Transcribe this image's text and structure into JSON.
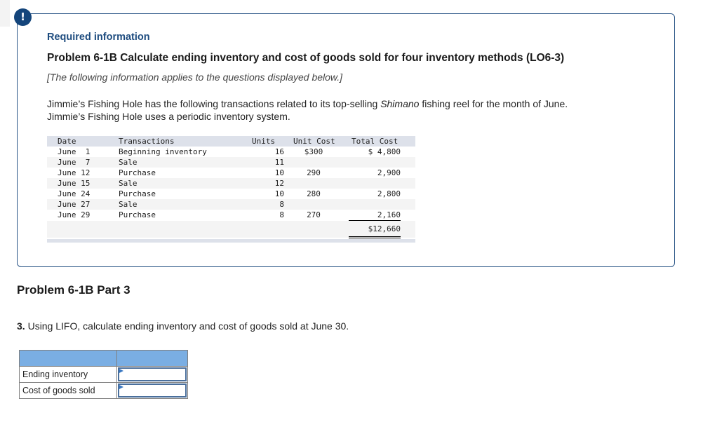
{
  "alert_icon": "!",
  "header": {
    "required_info": "Required information",
    "problem_title": "Problem 6-1B Calculate ending inventory and cost of goods sold for four inventory methods (LO6-3)",
    "applies_note": "[The following information applies to the questions displayed below.]"
  },
  "description": {
    "part1": "Jimmie’s Fishing Hole has the following transactions related to its top-selling ",
    "brand": "Shimano",
    "part2": " fishing reel for the month of June.",
    "line2": "Jimmie’s Fishing Hole uses a periodic inventory system."
  },
  "transactions": {
    "headers": {
      "date": "Date",
      "transactions": "Transactions",
      "units": "Units",
      "unit_cost": "Unit Cost",
      "total_cost": "Total Cost"
    },
    "rows": [
      {
        "date": "June  1",
        "transaction": "Beginning inventory",
        "units": "16",
        "unit_cost": "$300",
        "total_cost": "$ 4,800"
      },
      {
        "date": "June  7",
        "transaction": "Sale",
        "units": "11",
        "unit_cost": "",
        "total_cost": ""
      },
      {
        "date": "June 12",
        "transaction": "Purchase",
        "units": "10",
        "unit_cost": "290",
        "total_cost": "2,900"
      },
      {
        "date": "June 15",
        "transaction": "Sale",
        "units": "12",
        "unit_cost": "",
        "total_cost": ""
      },
      {
        "date": "June 24",
        "transaction": "Purchase",
        "units": "10",
        "unit_cost": "280",
        "total_cost": "2,800"
      },
      {
        "date": "June 27",
        "transaction": "Sale",
        "units": "8",
        "unit_cost": "",
        "total_cost": ""
      },
      {
        "date": "June 29",
        "transaction": "Purchase",
        "units": "8",
        "unit_cost": "270",
        "total_cost": "2,160"
      }
    ],
    "grand_total": "$12,660"
  },
  "part": {
    "title": "Problem 6-1B Part 3",
    "question_number": "3.",
    "question_text": " Using LIFO, calculate ending inventory and cost of goods sold at June 30."
  },
  "answer_table": {
    "rows": [
      {
        "label": "Ending inventory",
        "value": ""
      },
      {
        "label": "Cost of goods sold",
        "value": ""
      }
    ]
  }
}
